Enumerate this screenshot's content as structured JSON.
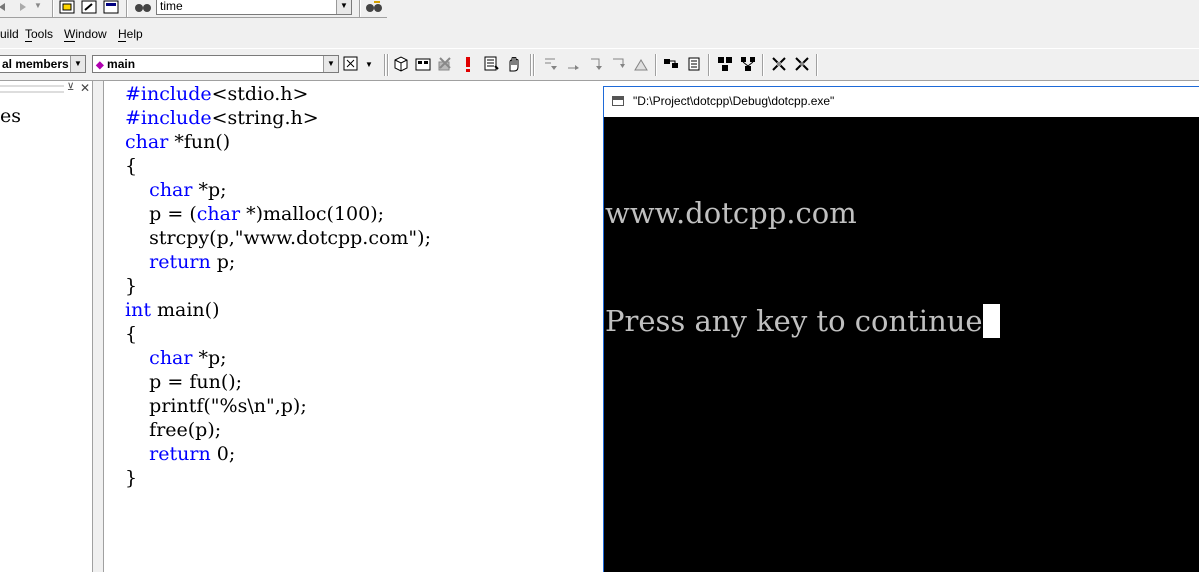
{
  "toolbar1": {
    "find_combo_value": "time"
  },
  "menu": {
    "items": [
      {
        "label": "uild"
      },
      {
        "label": "Tools"
      },
      {
        "label": "Window"
      },
      {
        "label": "Help"
      }
    ]
  },
  "toolbar2": {
    "members_combo_value": "al members",
    "function_combo_value": "main"
  },
  "workspace": {
    "tab_label": "es"
  },
  "editor": {
    "lines": [
      {
        "text": "#include<stdio.h>",
        "kind": "directive"
      },
      {
        "text": "#include<string.h>",
        "kind": "directive"
      },
      {
        "text": "char *fun()",
        "kind": "code"
      },
      {
        "text": "{",
        "kind": "code"
      },
      {
        "text": "    char *p;",
        "kind": "code"
      },
      {
        "text": "    p = (char *)malloc(100);",
        "kind": "code"
      },
      {
        "text": "    strcpy(p,\"www.dotcpp.com\");",
        "kind": "code"
      },
      {
        "text": "    return p;",
        "kind": "code"
      },
      {
        "text": "}",
        "kind": "code"
      },
      {
        "text": "int main()",
        "kind": "code"
      },
      {
        "text": "{",
        "kind": "code"
      },
      {
        "text": "    char *p;",
        "kind": "code"
      },
      {
        "text": "    p = fun();",
        "kind": "code"
      },
      {
        "text": "    printf(\"%s\\n\",p);",
        "kind": "code"
      },
      {
        "text": "    free(p);",
        "kind": "code"
      },
      {
        "text": "    return 0;",
        "kind": "code"
      },
      {
        "text": "}",
        "kind": "code"
      }
    ]
  },
  "console": {
    "title": "\"D:\\Project\\dotcpp\\Debug\\dotcpp.exe\"",
    "output_lines": [
      "www.dotcpp.com",
      "Press any key to continue"
    ]
  },
  "colors": {
    "keyword": "#0000ff",
    "console_bg": "#000000",
    "console_text": "#c0c0c0",
    "toolbar_bg": "#f0f0f0"
  }
}
